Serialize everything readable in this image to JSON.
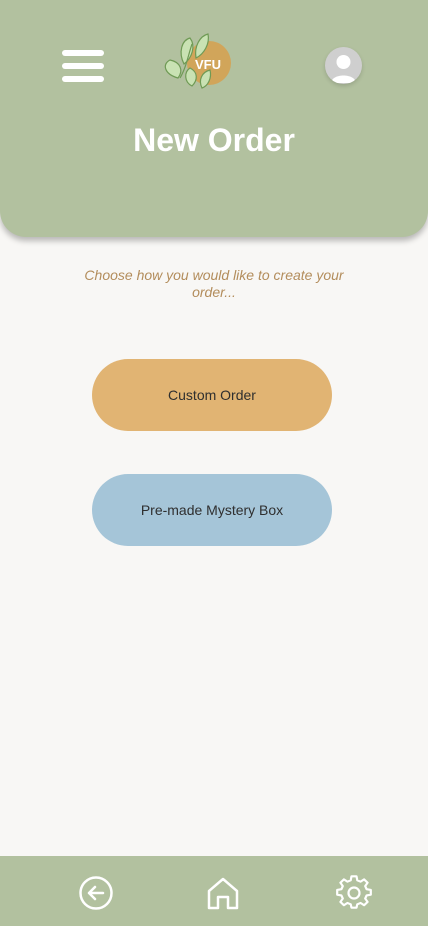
{
  "header": {
    "logo_text": "VFU",
    "title": "New Order"
  },
  "main": {
    "prompt": "Choose how you would like to create your order...",
    "options": [
      {
        "label": "Custom Order"
      },
      {
        "label": "Pre-made Mystery Box"
      }
    ]
  },
  "icons": {
    "menu": "hamburger-menu-icon",
    "logo": "leaf-logo-icon",
    "avatar": "user-avatar-icon",
    "back": "arrow-left-circle-icon",
    "home": "home-icon",
    "settings": "gear-icon"
  },
  "colors": {
    "header_bg": "#b2c19f",
    "page_bg": "#f8f7f5",
    "custom_order_btn": "#e1b473",
    "mystery_box_btn": "#a5c5d8",
    "prompt_text": "#b38d5c",
    "logo_circle": "#d1a55a"
  }
}
